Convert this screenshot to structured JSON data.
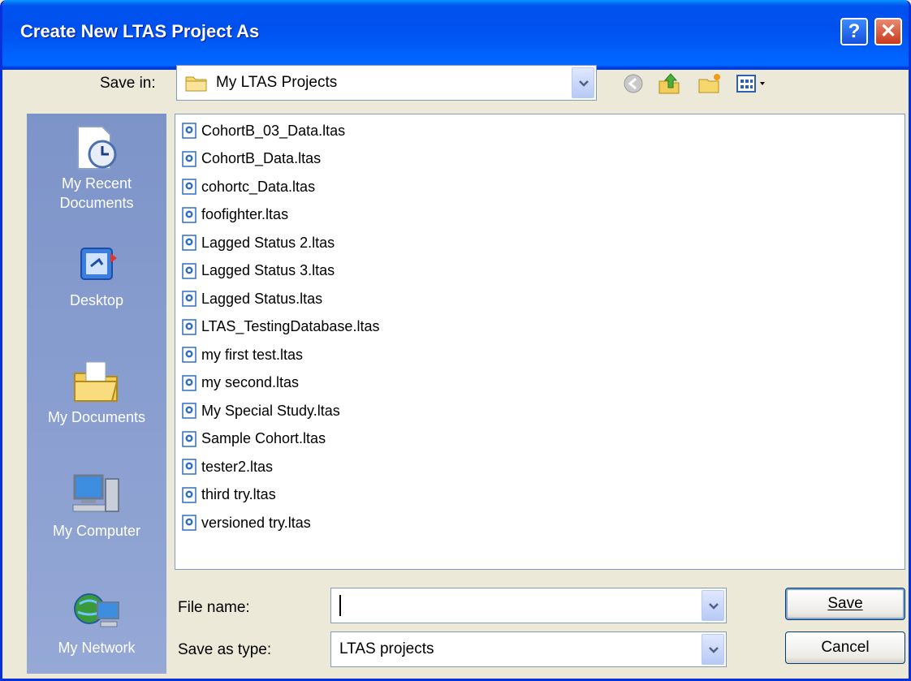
{
  "window": {
    "title": "Create New LTAS Project As"
  },
  "toolbar": {
    "save_in_label": "Save in:",
    "save_in_value": "My LTAS Projects"
  },
  "places": [
    {
      "label_line1": "My Recent",
      "label_line2": "Documents",
      "icon": "recent-documents-icon"
    },
    {
      "label_line1": "Desktop",
      "label_line2": "",
      "icon": "desktop-icon"
    },
    {
      "label_line1": "My Documents",
      "label_line2": "",
      "icon": "my-documents-icon"
    },
    {
      "label_line1": "My Computer",
      "label_line2": "",
      "icon": "my-computer-icon"
    },
    {
      "label_line1": "My Network",
      "label_line2": "",
      "icon": "my-network-icon"
    }
  ],
  "files": [
    "CohortB_03_Data.ltas",
    "CohortB_Data.ltas",
    "cohortc_Data.ltas",
    "foofighter.ltas",
    "Lagged Status 2.ltas",
    "Lagged Status 3.ltas",
    "Lagged Status.ltas",
    "LTAS_TestingDatabase.ltas",
    "my first test.ltas",
    "my second.ltas",
    "My Special Study.ltas",
    "Sample Cohort.ltas",
    "tester2.ltas",
    "third try.ltas",
    "versioned try.ltas"
  ],
  "form": {
    "file_name_label": "File name:",
    "file_name_value": "",
    "save_as_type_label": "Save as type:",
    "save_as_type_value": "LTAS projects"
  },
  "buttons": {
    "save": "Save",
    "cancel": "Cancel"
  },
  "colors": {
    "title_bar": "#0053ee",
    "places_bar": "#8e9ec9",
    "dialog_bg": "#ece9d8"
  }
}
